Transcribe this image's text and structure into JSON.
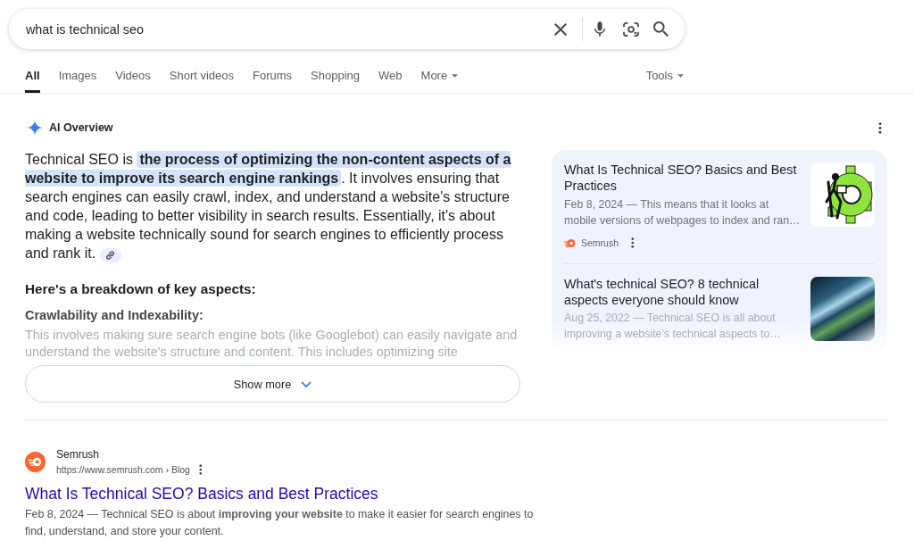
{
  "search": {
    "value": "what is technical seo"
  },
  "tabs": [
    {
      "label": "All",
      "selected": true,
      "kind": "link"
    },
    {
      "label": "Images",
      "selected": false,
      "kind": "link"
    },
    {
      "label": "Videos",
      "selected": false,
      "kind": "link"
    },
    {
      "label": "Short videos",
      "selected": false,
      "kind": "link"
    },
    {
      "label": "Forums",
      "selected": false,
      "kind": "link"
    },
    {
      "label": "Shopping",
      "selected": false,
      "kind": "link"
    },
    {
      "label": "Web",
      "selected": false,
      "kind": "link"
    },
    {
      "label": "More",
      "selected": false,
      "kind": "menu"
    }
  ],
  "tools": {
    "label": "Tools"
  },
  "ai_overview": {
    "title": "AI Overview",
    "summary": "Technical SEO is **the process of optimizing the non-content aspects of a website to improve its search engine rankings**. It involves ensuring that search engines can easily crawl, index, and understand a website's structure and code, leading to better visibility in search results. Essentially, it's about making a website technically sound for search engines to efficiently process and rank it.",
    "heading": "Here's a breakdown of key aspects:",
    "subheading": "Crawlability and Indexability:",
    "detail": "This involves making sure search engine bots (like Googlebot) can easily navigate and understand the website's structure and content. This includes optimizing site",
    "show_more": "Show more",
    "sources": [
      {
        "title": "What Is Technical SEO? Basics and Best Practices",
        "snippet": "Feb 8, 2024 — This means that it looks at mobile versions of webpages to index and ran…",
        "source": "Semrush",
        "kind": "illustration"
      },
      {
        "title": "What's technical SEO? 8 technical aspects everyone should know",
        "snippet": "Aug 25, 2022 — Technical SEO is all about improving a website's technical aspects to…",
        "kind": "photo"
      }
    ]
  },
  "result": {
    "site": "Semrush",
    "url": "https://www.semrush.com › Blog",
    "title": "What Is Technical SEO? Basics and Best Practices",
    "snippet": "Feb 8, 2024 — Technical SEO is about **improving your website** to make it easier for search engines to find, understand, and store your content."
  }
}
